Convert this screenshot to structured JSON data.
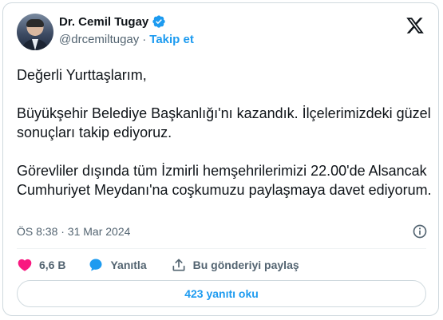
{
  "author": {
    "name": "Dr. Cemil Tugay",
    "handle": "@drcemiltugay",
    "separator": "·",
    "follow_label": "Takip et"
  },
  "tweet": {
    "paragraphs": [
      "Değerli Yurttaşlarım,",
      "Büyükşehir Belediye Başkanlığı'nı kazandık. İlçelerimizdeki güzel sonuçları takip ediyoruz.",
      "Görevliler dışında tüm İzmirli hemşehrilerimizi 22.00'de Alsancak Cumhuriyet Meydanı'na coşkumuzu paylaşmaya davet ediyorum."
    ],
    "timestamp": "ÖS 8:38 · 31 Mar 2024"
  },
  "actions": {
    "likes_count": "6,6 B",
    "reply_label": "Yanıtla",
    "share_label": "Bu gönderiyi paylaş"
  },
  "replies_button_label": "423 yanıtı oku",
  "icons": {
    "verified": "verified-badge-icon",
    "logo": "x-logo-icon",
    "info": "info-icon",
    "like": "heart-icon",
    "reply": "speech-bubble-icon",
    "share": "upload-share-icon"
  },
  "colors": {
    "accent": "#1d9bf0",
    "like": "#f91880",
    "text": "#0f1419",
    "muted": "#536471",
    "border": "#cfd9de"
  }
}
